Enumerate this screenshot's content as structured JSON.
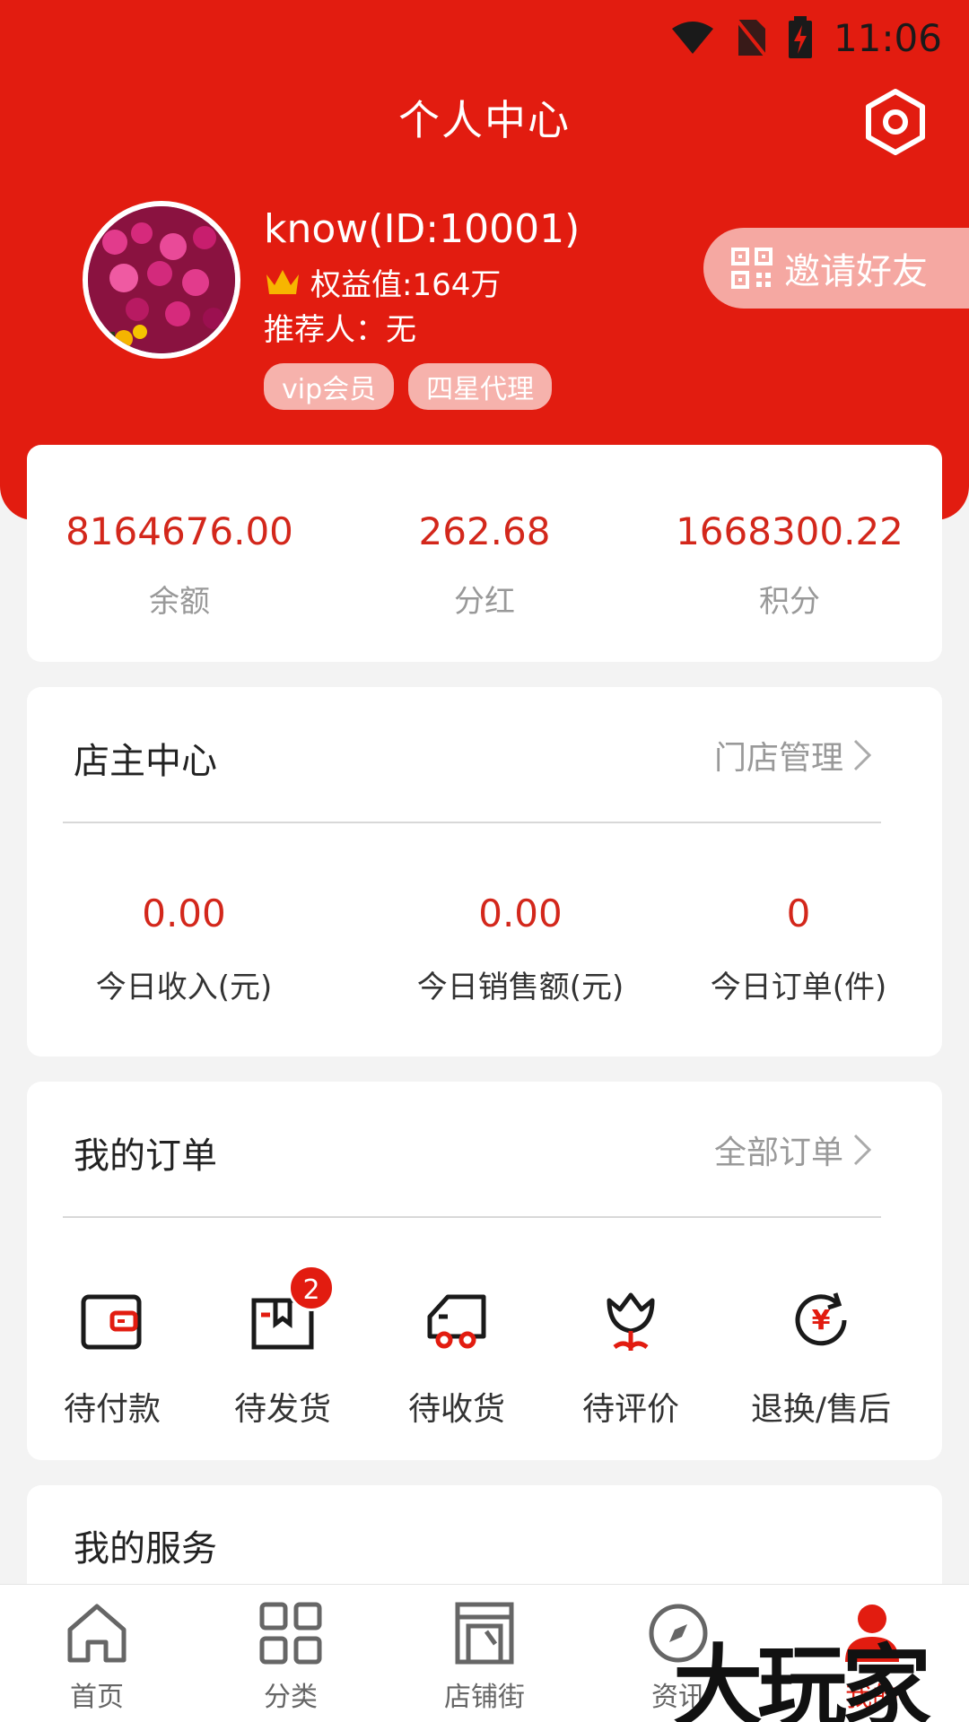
{
  "status_bar": {
    "time": "11:06"
  },
  "header": {
    "title": "个人中心"
  },
  "profile": {
    "name": "know(ID:10001)",
    "rights": "权益值:164万",
    "referrer": "推荐人：无",
    "tags": [
      "vip会员",
      "四星代理"
    ]
  },
  "invite": {
    "label": "邀请好友"
  },
  "stats": [
    {
      "value": "8164676.00",
      "label": "余额"
    },
    {
      "value": "262.68",
      "label": "分红"
    },
    {
      "value": "1668300.22",
      "label": "积分"
    }
  ],
  "shop": {
    "title": "店主中心",
    "link": "门店管理",
    "kpis": [
      {
        "value": "0.00",
        "label": "今日收入(元)"
      },
      {
        "value": "0.00",
        "label": "今日销售额(元)"
      },
      {
        "value": "0",
        "label": "今日订单(件)"
      }
    ]
  },
  "orders": {
    "title": "我的订单",
    "link": "全部订单",
    "items": [
      {
        "label": "待付款",
        "icon": "wallet-icon"
      },
      {
        "label": "待发货",
        "icon": "package-icon",
        "badge": "2"
      },
      {
        "label": "待收货",
        "icon": "truck-icon"
      },
      {
        "label": "待评价",
        "icon": "flower-icon"
      },
      {
        "label": "退换/售后",
        "icon": "refund-icon"
      }
    ]
  },
  "services": {
    "title": "我的服务"
  },
  "tabbar": [
    {
      "label": "首页",
      "icon": "home-icon"
    },
    {
      "label": "分类",
      "icon": "grid-icon"
    },
    {
      "label": "店铺街",
      "icon": "store-icon"
    },
    {
      "label": "资讯",
      "icon": "compass-icon"
    },
    {
      "label": "我的",
      "icon": "user-icon",
      "active": true
    }
  ],
  "watermark": "大玩家",
  "colors": {
    "brand_red": "#e21c10",
    "value_red": "#d3271b"
  }
}
